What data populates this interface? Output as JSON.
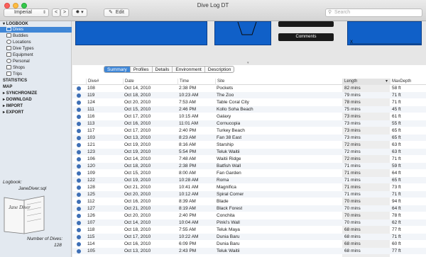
{
  "window": {
    "title": "Dive Log DT"
  },
  "toolbar": {
    "units": "Imperial",
    "back": "<",
    "forward": ">",
    "edit_label": "Edit",
    "search_placeholder": "Search"
  },
  "colors": {
    "accent": "#3f86d6",
    "profile_blue": "#1060c8",
    "dive_dot": "#3e6fb5"
  },
  "sidebar": {
    "logbook": "LOGBOOK",
    "items": [
      "Dives",
      "Buddies",
      "Locations",
      "Dive Types",
      "Equipment",
      "Personal",
      "Shops",
      "Trips"
    ],
    "statistics": "STATISTICS",
    "map": "MAP",
    "synchronize": "SYNCHRONIZE",
    "download": "DOWNLOAD",
    "import": "IMPORT",
    "export": "EXPORT",
    "logbook_label": "Logbook:",
    "logbook_file": "JaneDiver.sql",
    "book_text": "Jane Diver",
    "dives_label": "Number of Dives:",
    "dives_count": "128"
  },
  "profile": {
    "button1": "",
    "button2": "Comments",
    "axis_label": "X"
  },
  "tabs": [
    "Summary",
    "Profiles",
    "Details",
    "Environment",
    "Description"
  ],
  "table": {
    "columns": [
      "Dive#",
      "Date",
      "Time",
      "Site",
      "Length",
      "MaxDepth"
    ],
    "rows": [
      [
        "108",
        "Oct 14, 2010",
        "2:38 PM",
        "Pockets",
        "82 mins",
        "58 ft"
      ],
      [
        "119",
        "Oct 18, 2010",
        "10:23 AM",
        "The Zoo",
        "79 mins",
        "71 ft"
      ],
      [
        "124",
        "Oct 20, 2010",
        "7:53 AM",
        "Table Coral City",
        "78 mins",
        "71 ft"
      ],
      [
        "111",
        "Oct 15, 2010",
        "2:46 PM",
        "Kollo Soha Beach",
        "75 mins",
        "45 ft"
      ],
      [
        "116",
        "Oct 17, 2010",
        "10:15 AM",
        "Galaxy",
        "73 mins",
        "61 ft"
      ],
      [
        "113",
        "Oct 16, 2010",
        "11:01 AM",
        "Cornucopia",
        "73 mins",
        "55 ft"
      ],
      [
        "117",
        "Oct 17, 2010",
        "2:40 PM",
        "Turkey Beach",
        "73 mins",
        "65 ft"
      ],
      [
        "103",
        "Oct 13, 2010",
        "8:23 AM",
        "Fan 38 East",
        "73 mins",
        "65 ft"
      ],
      [
        "121",
        "Oct 19, 2010",
        "8:16 AM",
        "Starship",
        "72 mins",
        "63 ft"
      ],
      [
        "123",
        "Oct 19, 2010",
        "5:54 PM",
        "Teluk Waitii",
        "72 mins",
        "63 ft"
      ],
      [
        "106",
        "Oct 14, 2010",
        "7:48 AM",
        "Waitii Ridge",
        "72 mins",
        "71 ft"
      ],
      [
        "120",
        "Oct 18, 2010",
        "2:38 PM",
        "Batfish Wall",
        "71 mins",
        "59 ft"
      ],
      [
        "109",
        "Oct 15, 2010",
        "8:00 AM",
        "Fan Garden",
        "71 mins",
        "64 ft"
      ],
      [
        "122",
        "Oct 19, 2010",
        "10:28 AM",
        "Roma",
        "71 mins",
        "65 ft"
      ],
      [
        "128",
        "Oct 21, 2010",
        "10:41 AM",
        "Magnifica",
        "71 mins",
        "73 ft"
      ],
      [
        "125",
        "Oct 20, 2010",
        "10:12 AM",
        "Spiral Corner",
        "71 mins",
        "71 ft"
      ],
      [
        "112",
        "Oct 16, 2010",
        "8:39 AM",
        "Blade",
        "70 mins",
        "94 ft"
      ],
      [
        "127",
        "Oct 21, 2010",
        "8:19 AM",
        "Black Forest",
        "70 mins",
        "64 ft"
      ],
      [
        "126",
        "Oct 20, 2010",
        "2:40 PM",
        "Conchita",
        "70 mins",
        "78 ft"
      ],
      [
        "107",
        "Oct 14, 2010",
        "10:04 AM",
        "Pinki's Wall",
        "70 mins",
        "62 ft"
      ],
      [
        "118",
        "Oct 18, 2010",
        "7:55 AM",
        "Teluk Maya",
        "68 mins",
        "77 ft"
      ],
      [
        "115",
        "Oct 17, 2010",
        "10:22 AM",
        "Dunia Baru",
        "68 mins",
        "71 ft"
      ],
      [
        "114",
        "Oct 16, 2010",
        "6:09 PM",
        "Dunia Baru",
        "68 mins",
        "60 ft"
      ],
      [
        "105",
        "Oct 13, 2010",
        "2:43 PM",
        "Teluk Waitii",
        "68 mins",
        "77 ft"
      ]
    ]
  }
}
